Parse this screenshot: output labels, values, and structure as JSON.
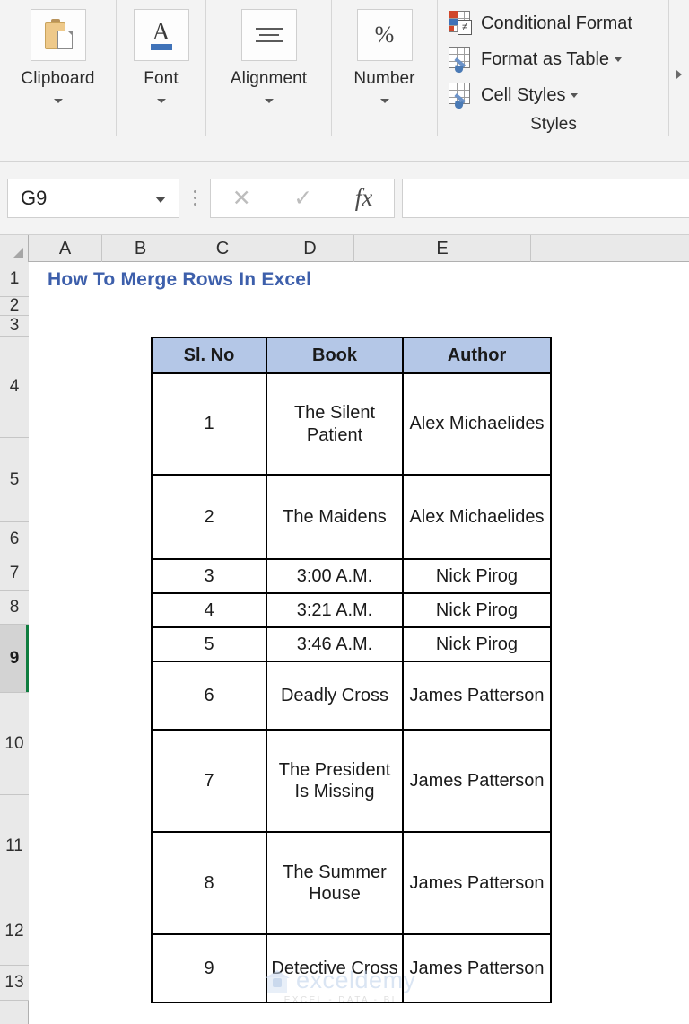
{
  "ribbon": {
    "groups": [
      {
        "label": "Clipboard",
        "icon": "clipboard-icon",
        "has_dialog_launcher": true
      },
      {
        "label": "Font",
        "icon": "font-a-icon",
        "has_dialog_launcher": true
      },
      {
        "label": "Alignment",
        "icon": "alignment-lines-icon",
        "has_dialog_launcher": true
      },
      {
        "label": "Number",
        "icon": "percent-icon",
        "has_dialog_launcher": true
      }
    ],
    "styles": {
      "caption": "Styles",
      "items": [
        {
          "label": "Conditional Format",
          "icon": "conditional-formatting-icon",
          "caret": false
        },
        {
          "label": "Format as Table",
          "icon": "format-as-table-icon",
          "caret": true
        },
        {
          "label": "Cell Styles",
          "icon": "cell-styles-icon",
          "caret": true
        }
      ]
    },
    "expand_arrow": "ribbon-expand-icon"
  },
  "formula_bar": {
    "name_box_value": "G9",
    "name_box_caret": "chevron-down-icon",
    "cancel_icon": "✕",
    "enter_icon": "✓",
    "function_icon": "fx",
    "formula_value": ""
  },
  "grid": {
    "columns": [
      "A",
      "B",
      "C",
      "D",
      "E"
    ],
    "rows": [
      "1",
      "2",
      "3",
      "4",
      "5",
      "6",
      "7",
      "8",
      "9",
      "10",
      "11",
      "12",
      "13"
    ],
    "selected_row": "9",
    "title": "How To Merge Rows In Excel",
    "title_color": "#3d5fab"
  },
  "table": {
    "header_fill": "#b4c7e7",
    "headers": [
      "Sl. No",
      "Book",
      "Author"
    ],
    "rows": [
      {
        "sl": "1",
        "book": "The Silent Patient",
        "author": "Alex Michaelides"
      },
      {
        "sl": "2",
        "book": "The Maidens",
        "author": "Alex Michaelides"
      },
      {
        "sl": "3",
        "book": "3:00 A.M.",
        "author": "Nick Pirog"
      },
      {
        "sl": "4",
        "book": "3:21 A.M.",
        "author": "Nick Pirog"
      },
      {
        "sl": "5",
        "book": "3:46 A.M.",
        "author": "Nick Pirog"
      },
      {
        "sl": "6",
        "book": "Deadly Cross",
        "author": "James Patterson"
      },
      {
        "sl": "7",
        "book": "The President Is Missing",
        "author": "James Patterson"
      },
      {
        "sl": "8",
        "book": "The Summer House",
        "author": "James Patterson"
      },
      {
        "sl": "9",
        "book": "Detective Cross",
        "author": "James Patterson"
      }
    ]
  },
  "watermark": {
    "brand": "exceldemy",
    "tagline": "EXCEL - DATA - BI"
  }
}
